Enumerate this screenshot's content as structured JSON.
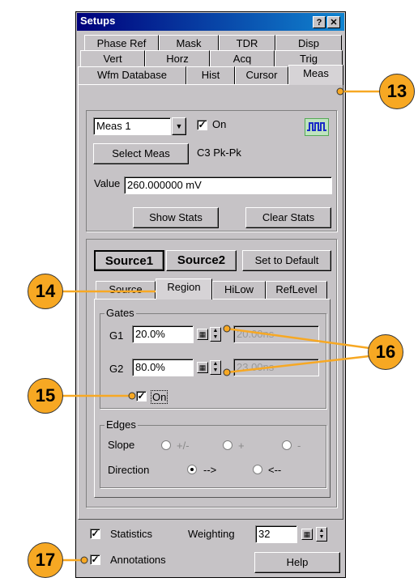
{
  "window": {
    "title": "Setups",
    "help_btn": "?",
    "close_btn": "✕"
  },
  "tabs": {
    "row1": [
      "Phase Ref",
      "Mask",
      "TDR",
      "Disp"
    ],
    "row2": [
      "Vert",
      "Horz",
      "Acq",
      "Trig"
    ],
    "row3": [
      "Wfm Database",
      "Hist",
      "Cursor",
      "Meas"
    ]
  },
  "meas": {
    "select_value": "Meas 1",
    "on_label": "On",
    "select_btn": "Select Meas",
    "meas_name": "C3 Pk-Pk",
    "value_label": "Value",
    "value_text": "260.000000 mV",
    "show_stats": "Show Stats",
    "clear_stats": "Clear Stats"
  },
  "source": {
    "source1": "Source1",
    "source2": "Source2",
    "set_default": "Set to Default",
    "subtabs": [
      "Source",
      "Region",
      "HiLow",
      "RefLevel"
    ]
  },
  "gates": {
    "legend": "Gates",
    "g1_label": "G1",
    "g1_value": "20.0%",
    "g1_time": "20.00ns",
    "g2_label": "G2",
    "g2_value": "80.0%",
    "g2_time": "23.00ns",
    "on_label": "On"
  },
  "edges": {
    "legend": "Edges",
    "slope_label": "Slope",
    "slope_opts": [
      "+/-",
      "+",
      "-"
    ],
    "direction_label": "Direction",
    "direction_opts": [
      "-->",
      "<--"
    ]
  },
  "footer": {
    "statistics": "Statistics",
    "weighting_label": "Weighting",
    "weighting_value": "32",
    "annotations": "Annotations",
    "help": "Help"
  },
  "callouts": [
    "13",
    "14",
    "15",
    "16",
    "17"
  ]
}
